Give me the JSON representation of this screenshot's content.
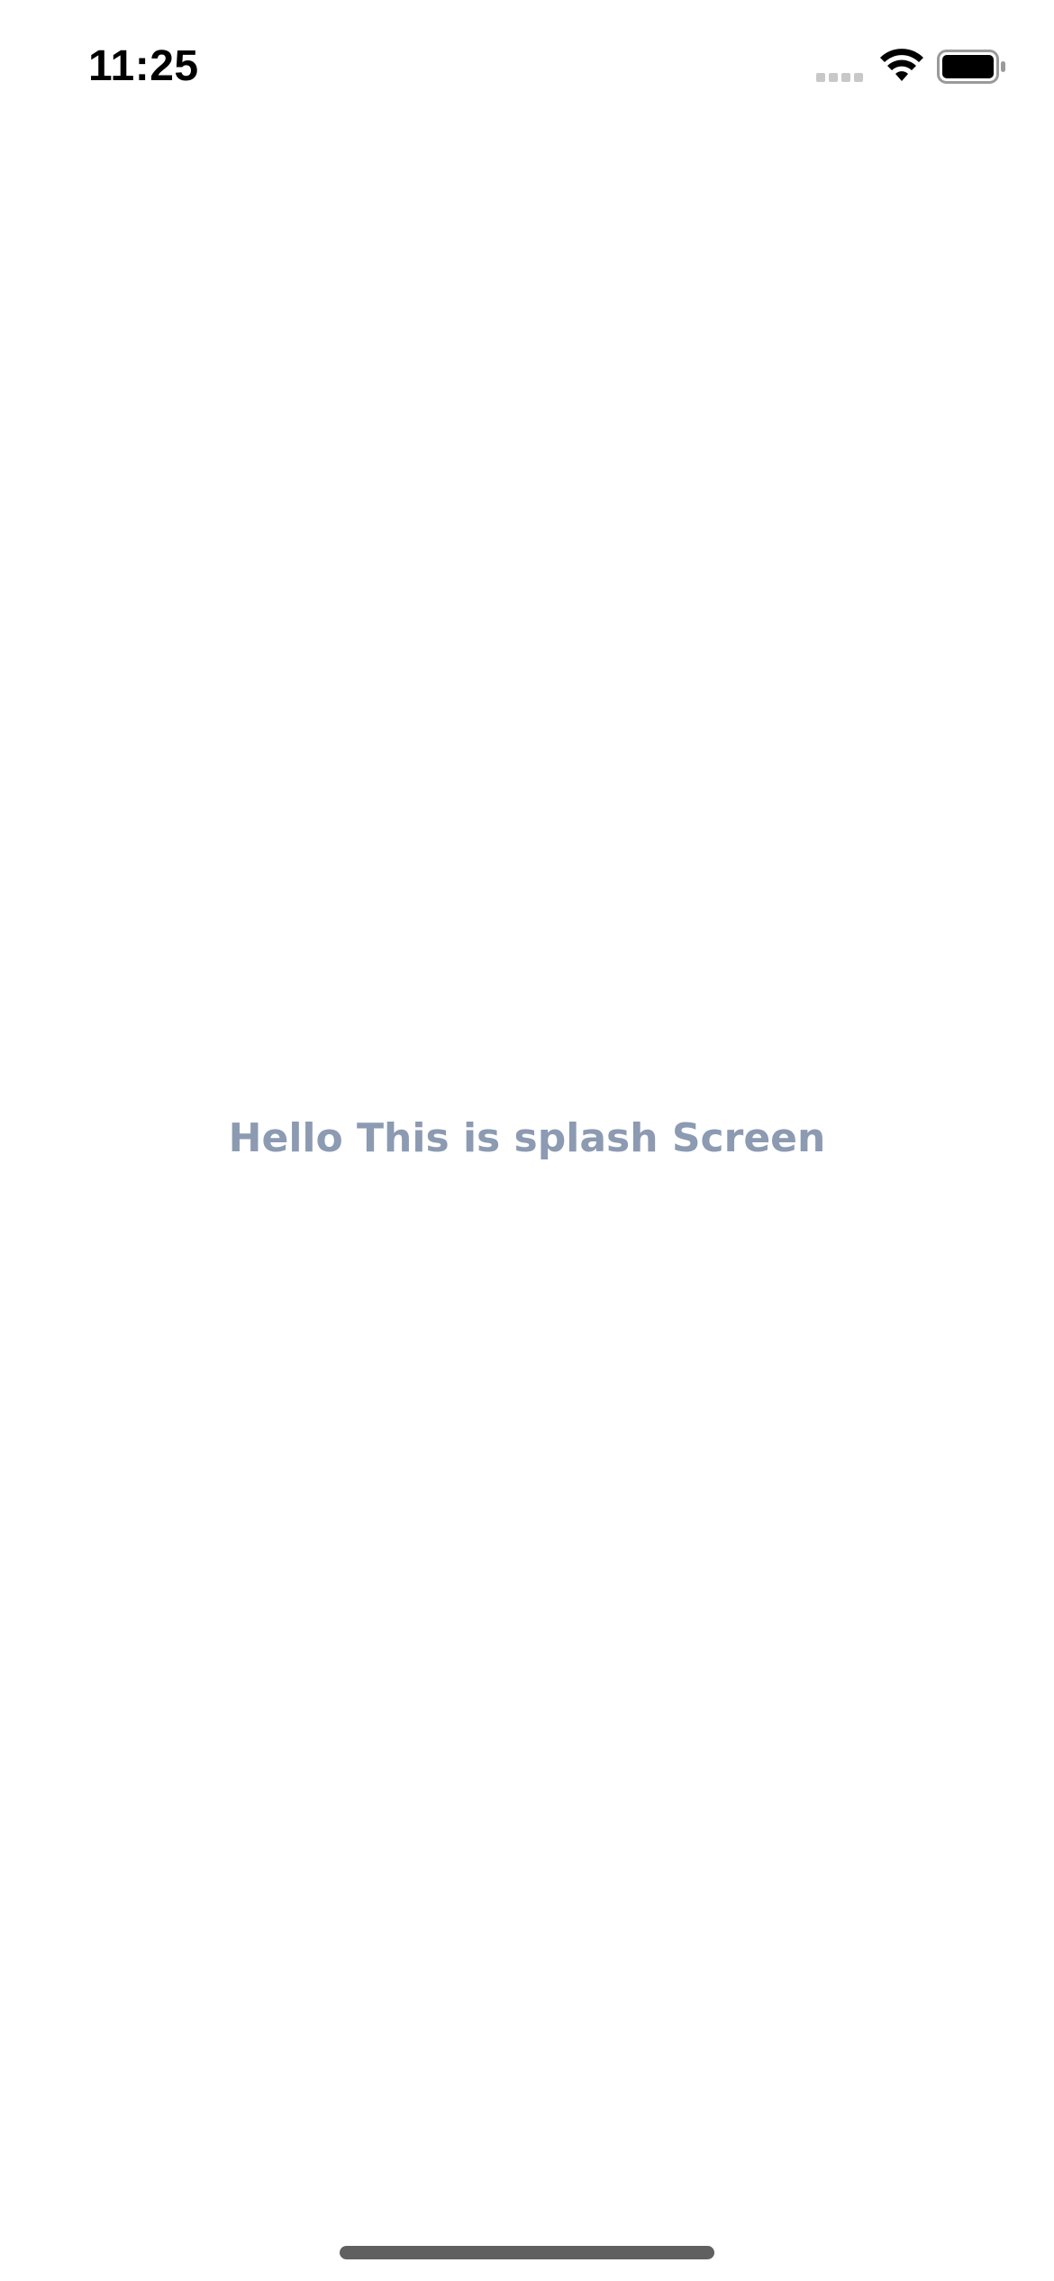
{
  "status_bar": {
    "time": "11:25",
    "signal_icon": "cellular-signal-icon",
    "wifi_icon": "wifi-icon",
    "battery_icon": "battery-icon"
  },
  "splash": {
    "message": "Hello This is splash Screen",
    "text_color": "#8c9ab2"
  },
  "colors": {
    "background": "#ffffff",
    "home_indicator": "#606060"
  }
}
